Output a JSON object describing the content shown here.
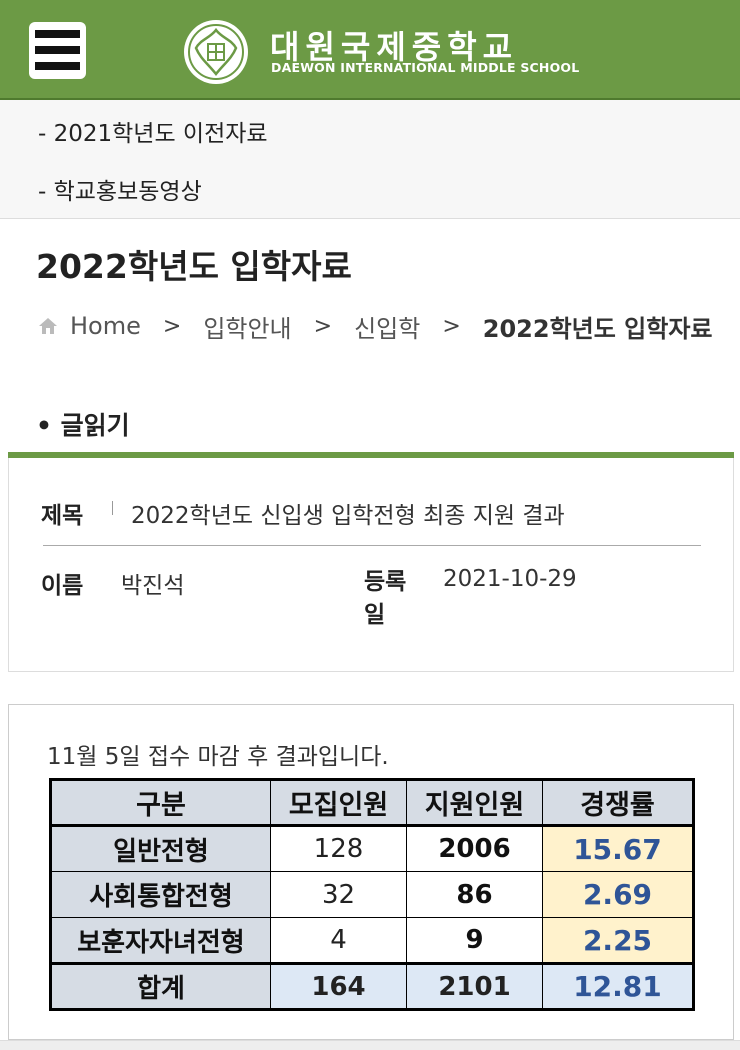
{
  "header": {
    "school_name_ko": "대원국제중학교",
    "school_name_en": "DAEWON INTERNATIONAL MIDDLE SCHOOL",
    "menu_icon": "hamburger-menu-icon",
    "logo_icon": "school-emblem-icon",
    "brand_color": "#6c9a45"
  },
  "submenu": {
    "items": [
      {
        "label": "- 2021학년도 이전자료"
      },
      {
        "label": "- 학교홍보동영상"
      }
    ]
  },
  "page_title": "2022학년도 입학자료",
  "breadcrumb": {
    "home_icon": "home-icon",
    "items": [
      {
        "label": "Home"
      },
      {
        "label": "입학안내"
      },
      {
        "label": "신입학"
      },
      {
        "label": "2022학년도 입학자료"
      }
    ],
    "separator": ">"
  },
  "section_label": "• 글읽기",
  "post": {
    "title_label": "제목",
    "title": "2022학년도 신입생 입학전형 최종 지원 결과",
    "author_label": "이름",
    "author": "박진석",
    "date_label": "등록일",
    "date": "2021-10-29"
  },
  "content": {
    "notice": "11월 5일 접수 마감 후 결과입니다.",
    "table": {
      "headers": [
        "구분",
        "모집인원",
        "지원인원",
        "경쟁률"
      ],
      "rows": [
        {
          "category": "일반전형",
          "quota": "128",
          "applicants": "2006",
          "rate": "15.67"
        },
        {
          "category": "사회통합전형",
          "quota": "32",
          "applicants": "86",
          "rate": "2.69"
        },
        {
          "category": "보훈자자녀전형",
          "quota": "4",
          "applicants": "9",
          "rate": "2.25"
        }
      ],
      "total": {
        "category": "합계",
        "quota": "164",
        "applicants": "2101",
        "rate": "12.81"
      }
    }
  }
}
